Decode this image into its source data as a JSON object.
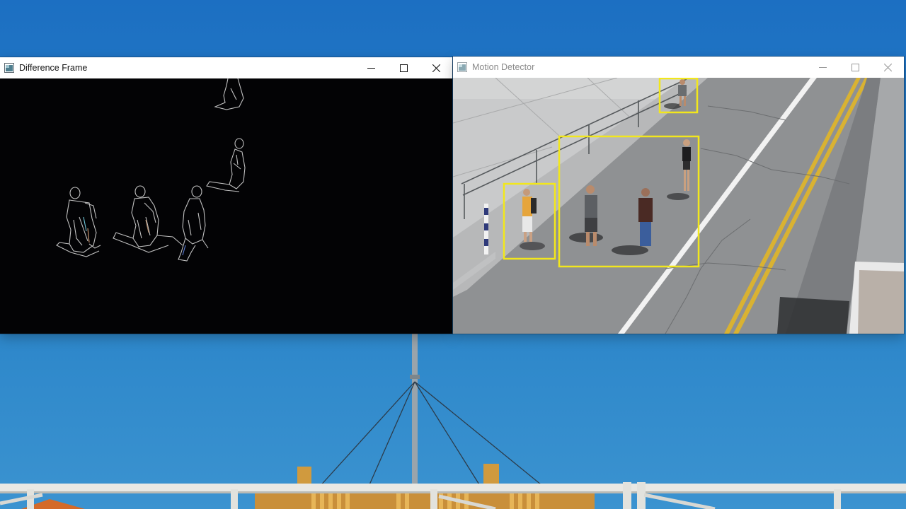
{
  "desktop": {
    "wallpaper": "sky-with-railing-and-mast"
  },
  "windows": [
    {
      "title": "Difference Frame",
      "active": true,
      "icon": "app-window-icon",
      "controls": [
        "minimize-icon",
        "maximize-icon",
        "close-icon"
      ]
    },
    {
      "title": "Motion Detector",
      "active": false,
      "icon": "app-window-icon",
      "controls": [
        "minimize-icon",
        "maximize-icon",
        "close-icon"
      ]
    }
  ],
  "colors": {
    "detection_box": "#f2e71c",
    "difference_background": "#030305",
    "sky": "#2a83c8"
  }
}
